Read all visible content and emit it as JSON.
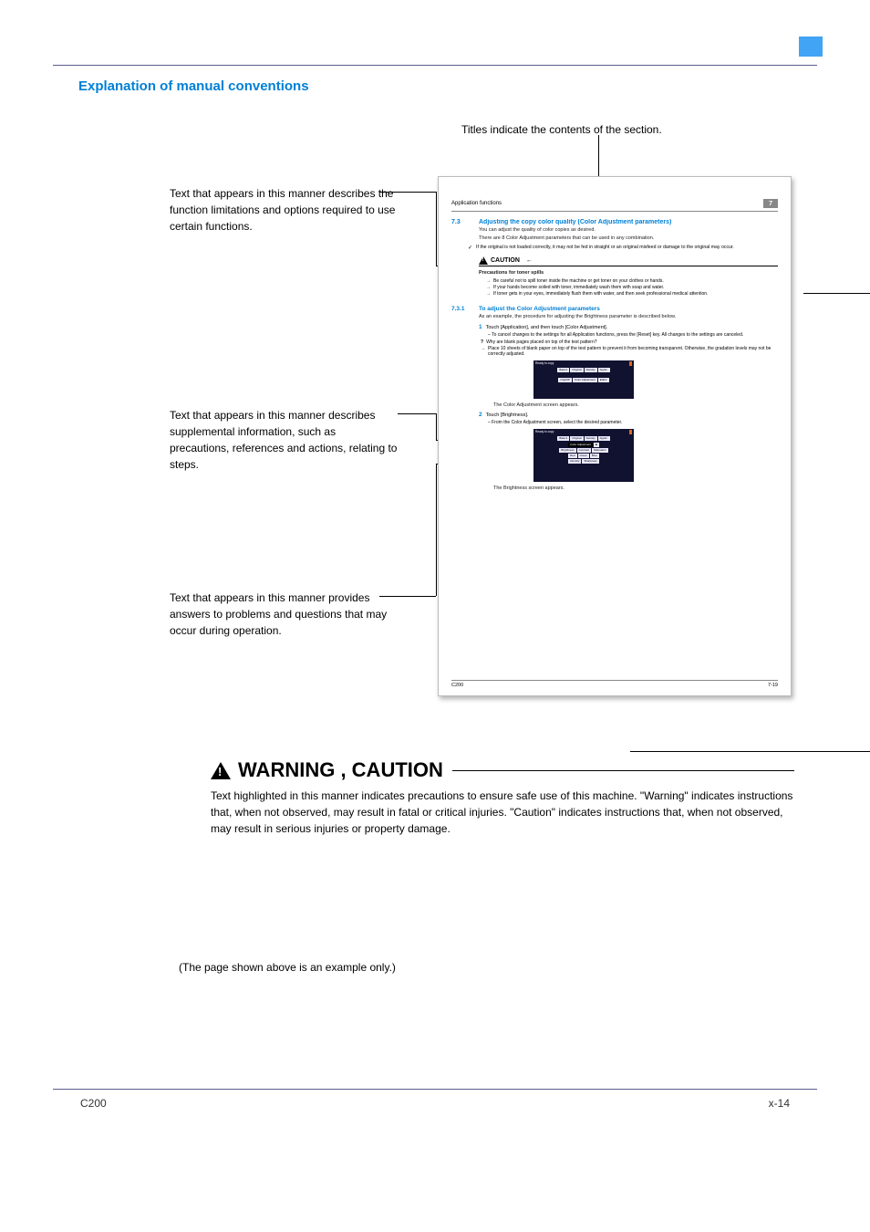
{
  "header": {
    "square_color": "#41a4f4"
  },
  "section_title": "Explanation of manual conventions",
  "labels": {
    "titles": "Titles indicate the contents of the section.",
    "l1": "Text that appears in this manner describes the function limitations and options required to use certain functions.",
    "l2": "Text that appears in this manner describes supplemental information, such as precautions, references and actions, relating to steps.",
    "l3": "Text that appears in this manner provides answers to problems and questions that may occur during operation."
  },
  "preview": {
    "header_left": "Application functions",
    "header_num": "7",
    "s1_num": "7.3",
    "s1_title": "Adjusting the copy color quality (Color Adjustment parameters)",
    "s1_l1": "You can adjust the quality of color copies as desired.",
    "s1_l2": "There are 8 Color Adjustment parameters that can be used in any combination.",
    "check": "If the original is not loaded correctly, it may not be fed in straight or an original misfeed or damage to the original may occur.",
    "caution_hdr": "CAUTION",
    "caution_title": "Precautions for toner spills",
    "caution_a": "Be careful not to spill toner inside the machine or get toner on your clothes or hands.",
    "caution_b": "If your hands become soiled with toner, immediately wash them with soap and water.",
    "caution_c": "If toner gets in your eyes, immediately flush them with water, and then seek professional medical attention.",
    "s2_num": "7.3.1",
    "s2_title": "To adjust the Color Adjustment parameters",
    "s2_desc": "As an example, the procedure for adjusting the Brightness parameter is described below.",
    "step1_num": "1",
    "step1": "Touch [Application], and then touch [Color Adjustment].",
    "step1_dash": "–  To cancel changes to the settings for all Application functions, press the [Reset] key. All changes to the settings are canceled.",
    "q_text": "Why are blank pages placed on top of the test pattern?",
    "q_ans": "Place 10 sheets of blank paper on top of the test pattern to prevent it from becoming transparent. Otherwise, the gradation levels may not be correctly adjusted.",
    "after1": "The Color Adjustment screen appears.",
    "step2_num": "2",
    "step2": "Touch [Brightness].",
    "step2_dash": "–  From the Color Adjustment screen, select the desired parameter.",
    "after2": "The Brightness screen appears.",
    "ui_ready": "Ready to copy",
    "footer_l": "C200",
    "footer_r": "7-19"
  },
  "warning": {
    "head": "WARNING , CAUTION",
    "text": "Text highlighted in this manner indicates precautions to ensure safe use of this machine. \"Warning\" indicates instructions that, when not observed, may result in fatal or critical injuries. \"Caution\" indicates instructions that, when not observed, may result in serious injuries or property damage."
  },
  "example_note": "(The page shown above is an example only.)",
  "footer": {
    "left": "C200",
    "right": "x-14"
  }
}
